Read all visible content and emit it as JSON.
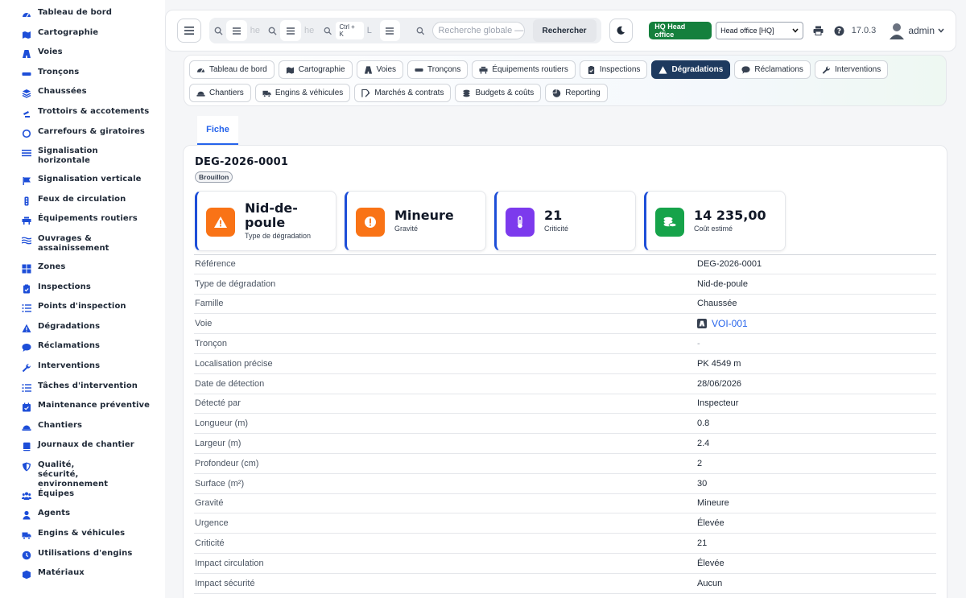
{
  "sidebar": {
    "items": [
      {
        "label": "Tableau de bord",
        "icon": "dashboard-icon"
      },
      {
        "label": "Cartographie",
        "icon": "map-icon"
      },
      {
        "label": "Voies",
        "icon": "road-icon"
      },
      {
        "label": "Tronçons",
        "icon": "segment-icon"
      },
      {
        "label": "Chaussées",
        "icon": "layers-icon"
      },
      {
        "label": "Trottoirs & accotements",
        "icon": "walk-icon"
      },
      {
        "label": "Carrefours & giratoires",
        "icon": "roundabout-icon"
      },
      {
        "label": "Signalisation horizontale",
        "icon": "stripes-icon"
      },
      {
        "label": "Signalisation verticale",
        "icon": "flag-icon"
      },
      {
        "label": "Feux de circulation",
        "icon": "traffic-light-icon"
      },
      {
        "label": "Équipements routiers",
        "icon": "barrier-icon"
      },
      {
        "label": "Ouvrages & assainissement",
        "icon": "water-icon"
      },
      {
        "label": "Zones",
        "icon": "zones-icon"
      },
      {
        "label": "Inspections",
        "icon": "clipboard-icon"
      },
      {
        "label": "Points d'inspection",
        "icon": "list-icon"
      },
      {
        "label": "Dégradations",
        "icon": "warning-icon"
      },
      {
        "label": "Réclamations",
        "icon": "chat-icon"
      },
      {
        "label": "Interventions",
        "icon": "wrench-icon"
      },
      {
        "label": "Tâches d'intervention",
        "icon": "tasks-icon"
      },
      {
        "label": "Maintenance préventive",
        "icon": "calendar-check-icon"
      },
      {
        "label": "Chantiers",
        "icon": "helmet-icon"
      },
      {
        "label": "Journaux de chantier",
        "icon": "book-icon"
      },
      {
        "label": "Qualité, sécurité, environnement",
        "icon": "shield-icon"
      },
      {
        "label": "Équipes",
        "icon": "users-icon"
      },
      {
        "label": "Agents",
        "icon": "user-icon"
      },
      {
        "label": "Engins & véhicules",
        "icon": "truck-icon"
      },
      {
        "label": "Utilisations d'engins",
        "icon": "clock-icon"
      },
      {
        "label": "Matériaux",
        "icon": "box-icon"
      }
    ]
  },
  "topbar": {
    "mini_search_1": "he",
    "mini_search_2": "he",
    "mini_search_3": "L",
    "shortcut": "Ctrl + K",
    "global_placeholder": "Recherche globale — c",
    "search_button": "Rechercher",
    "hq_badge": "HQ Head office",
    "hq_select": "Head office [HQ]",
    "version": "17.0.3",
    "user": "admin"
  },
  "modules": {
    "row1": [
      {
        "label": "Tableau de bord",
        "icon": "dashboard-icon"
      },
      {
        "label": "Cartographie",
        "icon": "map-icon"
      },
      {
        "label": "Voies",
        "icon": "road-icon"
      },
      {
        "label": "Tronçons",
        "icon": "segment-icon"
      },
      {
        "label": "Équipements routiers",
        "icon": "barrier-icon"
      },
      {
        "label": "Inspections",
        "icon": "clipboard-icon"
      },
      {
        "label": "Dégradations",
        "icon": "warning-icon",
        "active": true
      },
      {
        "label": "Réclamations",
        "icon": "chat-icon"
      },
      {
        "label": "Interventions",
        "icon": "wrench-icon"
      }
    ],
    "row2": [
      {
        "label": "Chantiers",
        "icon": "helmet-icon"
      },
      {
        "label": "Engins & véhicules",
        "icon": "truck-icon"
      },
      {
        "label": "Marchés & contrats",
        "icon": "contract-icon"
      },
      {
        "label": "Budgets & coûts",
        "icon": "coins-icon"
      },
      {
        "label": "Reporting",
        "icon": "pie-icon"
      }
    ]
  },
  "tab": {
    "label": "Fiche"
  },
  "record": {
    "title": "DEG-2026-0001",
    "status": "Brouillon"
  },
  "kpis": [
    {
      "value": "Nid-de-poule",
      "label": "Type de dégradation",
      "color": "#f97316",
      "icon": "warning-icon"
    },
    {
      "value": "Mineure",
      "label": "Gravité",
      "color": "#f97316",
      "icon": "alert-circle-icon"
    },
    {
      "value": "21",
      "label": "Criticité",
      "color": "#7c3aed",
      "icon": "thermometer-icon"
    },
    {
      "value": "14 235,00",
      "label": "Coût estimé",
      "color": "#16a34a",
      "icon": "coins-icon"
    }
  ],
  "fields": [
    {
      "label": "Référence",
      "value": "DEG-2026-0001"
    },
    {
      "label": "Type de dégradation",
      "value": "Nid-de-poule"
    },
    {
      "label": "Famille",
      "value": "Chaussée"
    },
    {
      "label": "Voie",
      "value": "VOI-001",
      "link": true
    },
    {
      "label": "Tronçon",
      "value": "-",
      "muted": true
    },
    {
      "label": "Localisation précise",
      "value": "PK 4549 m"
    },
    {
      "label": "Date de détection",
      "value": "28/06/2026"
    },
    {
      "label": "Détecté par",
      "value": "Inspecteur"
    },
    {
      "label": "Longueur (m)",
      "value": "0.8"
    },
    {
      "label": "Largeur (m)",
      "value": "2.4"
    },
    {
      "label": "Profondeur (cm)",
      "value": "2"
    },
    {
      "label": "Surface (m²)",
      "value": "30"
    },
    {
      "label": "Gravité",
      "value": "Mineure"
    },
    {
      "label": "Urgence",
      "value": "Élevée"
    },
    {
      "label": "Criticité",
      "value": "21"
    },
    {
      "label": "Impact circulation",
      "value": "Élevée"
    },
    {
      "label": "Impact sécurité",
      "value": "Aucun"
    }
  ],
  "colors": {
    "accent": "#1d4ed8",
    "active_module": "#1e3a5f",
    "link": "#2563eb",
    "hq": "#15803d"
  }
}
